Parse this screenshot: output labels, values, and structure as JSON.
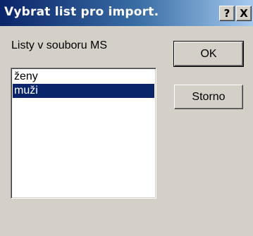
{
  "window": {
    "title": "Vybrat list pro import.",
    "help_label": "?",
    "close_label": "X"
  },
  "sheet_list": {
    "label": "Listy v souboru MS",
    "items": [
      {
        "label": "ženy",
        "selected": false
      },
      {
        "label": "muži",
        "selected": true
      }
    ]
  },
  "buttons": {
    "ok_label": "OK",
    "cancel_label": "Storno"
  },
  "colors": {
    "title_bar": "#0a246a",
    "selection": "#0a246a",
    "face": "#d4d0c8"
  }
}
